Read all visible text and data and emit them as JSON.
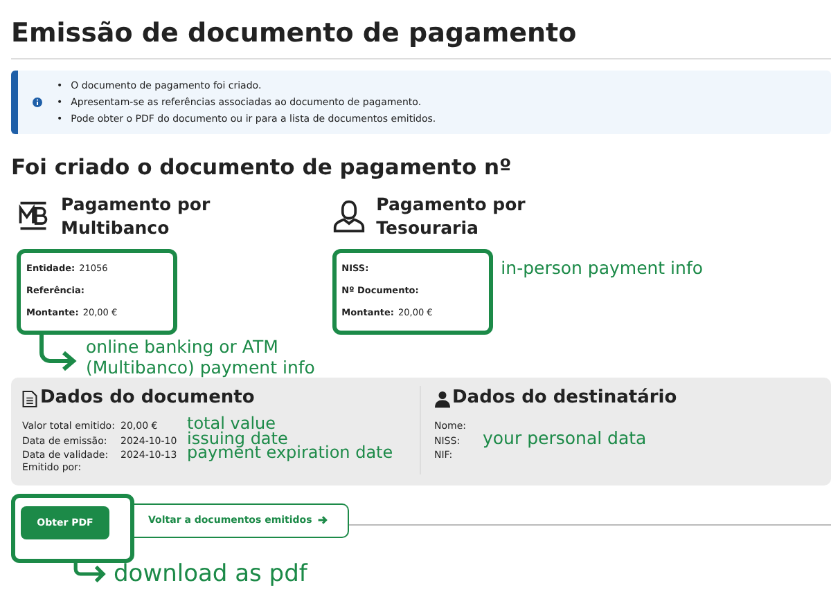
{
  "title": "Emissão de documento de pagamento",
  "info": {
    "items": [
      {
        "bullet": "•",
        "text": "O documento de pagamento foi criado."
      },
      {
        "bullet": "•",
        "text": "Apresentam-se as referências associadas ao documento de pagamento."
      },
      {
        "bullet": "•",
        "text": "Pode obter o PDF do documento ou ir para a lista de documentos emitidos."
      }
    ]
  },
  "heading": "Foi criado o documento de pagamento nº",
  "payments": [
    {
      "kind": "multibanco",
      "title": [
        "Pagamento por",
        "Multibanco"
      ],
      "fields": [
        {
          "label": "Entidade:",
          "value": "21056"
        },
        {
          "label": "Referência:"
        },
        {
          "label": "Montante:",
          "value": "20,00 €"
        }
      ]
    },
    {
      "kind": "tesouraria",
      "title": [
        "Pagamento por",
        "Tesouraria"
      ],
      "fields": [
        {
          "label": "NISS:"
        },
        {
          "label": "Nº Documento:"
        },
        {
          "label": "Montante:",
          "value": "20,00 €"
        }
      ],
      "annotation": "in-person payment info"
    }
  ],
  "multibanco_annotation": [
    "online banking or ATM",
    "(Multibanco) payment info"
  ],
  "document": {
    "title": "Dados do documento",
    "fields": [
      {
        "label": "Valor total emitido:",
        "value": "20,00 €",
        "annotation": "total value"
      },
      {
        "label": "Data de emissão:",
        "value": "2024-10-10",
        "annotation": "issuing date"
      },
      {
        "label": "Data de validade:",
        "value": "2024-10-13",
        "annotation": "payment expiration date"
      },
      {
        "label": "Emitido por:"
      }
    ]
  },
  "recipient": {
    "title": "Dados do destinatário",
    "fields": [
      {
        "label": "Nome:"
      },
      {
        "label": "NISS:"
      },
      {
        "label": "NIF:"
      }
    ],
    "annotation": "your personal data"
  },
  "buttons": [
    {
      "label": "Obter PDF",
      "kind": "primary"
    },
    {
      "label": "Voltar a documentos emitidos",
      "kind": "secondary"
    }
  ],
  "download_annotation": "download as pdf"
}
